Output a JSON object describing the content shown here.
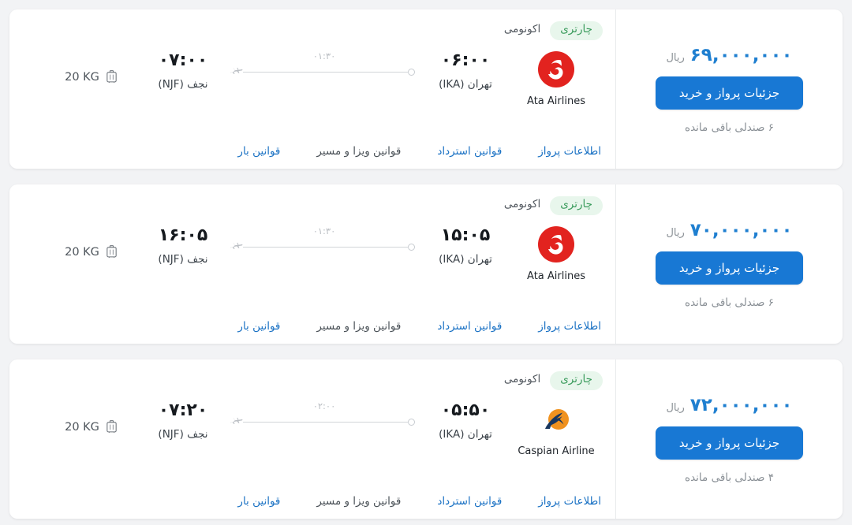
{
  "currency_label": "ریال",
  "buy_button_label": "جزئیات پرواز و خرید",
  "baggage_icon": "suitcase-icon",
  "plane_icon": "airplane-icon",
  "links": {
    "flight_info": "اطلاعات پرواز",
    "refund_rules": "قوانین استرداد",
    "visa_route_rules": "قوانین ویزا و مسیر",
    "baggage_rules": "قوانین بار"
  },
  "colors": {
    "accent_blue": "#1878d4",
    "price_blue": "#1f7fd0",
    "link_blue": "#1b72c4",
    "badge_green_bg": "#e8f6ec",
    "badge_green_text": "#3a9b5c",
    "page_background": "#f2f3f5",
    "card_background": "#ffffff",
    "ata_logo_red": "#e2231f",
    "caspian_logo_orange": "#f0921f",
    "caspian_logo_navy": "#18365e"
  },
  "flights": [
    {
      "badge_charter": "چارتری",
      "badge_class": "اکونومی",
      "airline_name": "Ata Airlines",
      "airline_logo": "ata-airlines-logo",
      "departure_time": "۰۶:۰۰",
      "departure_place": "تهران (IKA)",
      "arrival_time": "۰۷:۰۰",
      "arrival_place": "نجف (NJF)",
      "duration": "۰۱:۳۰",
      "baggage": "20 KG",
      "price_amount": "۶۹,۰۰۰,۰۰۰",
      "seats_left": "۶ صندلی باقی مانده"
    },
    {
      "badge_charter": "چارتری",
      "badge_class": "اکونومی",
      "airline_name": "Ata Airlines",
      "airline_logo": "ata-airlines-logo",
      "departure_time": "۱۵:۰۵",
      "departure_place": "تهران (IKA)",
      "arrival_time": "۱۶:۰۵",
      "arrival_place": "نجف (NJF)",
      "duration": "۰۱:۳۰",
      "baggage": "20 KG",
      "price_amount": "۷۰,۰۰۰,۰۰۰",
      "seats_left": "۶ صندلی باقی مانده"
    },
    {
      "badge_charter": "چارتری",
      "badge_class": "اکونومی",
      "airline_name": "Caspian Airline",
      "airline_logo": "caspian-airline-logo",
      "departure_time": "۰۵:۵۰",
      "departure_place": "تهران (IKA)",
      "arrival_time": "۰۷:۲۰",
      "arrival_place": "نجف (NJF)",
      "duration": "۰۲:۰۰",
      "baggage": "20 KG",
      "price_amount": "۷۲,۰۰۰,۰۰۰",
      "seats_left": "۴ صندلی باقی مانده"
    }
  ]
}
